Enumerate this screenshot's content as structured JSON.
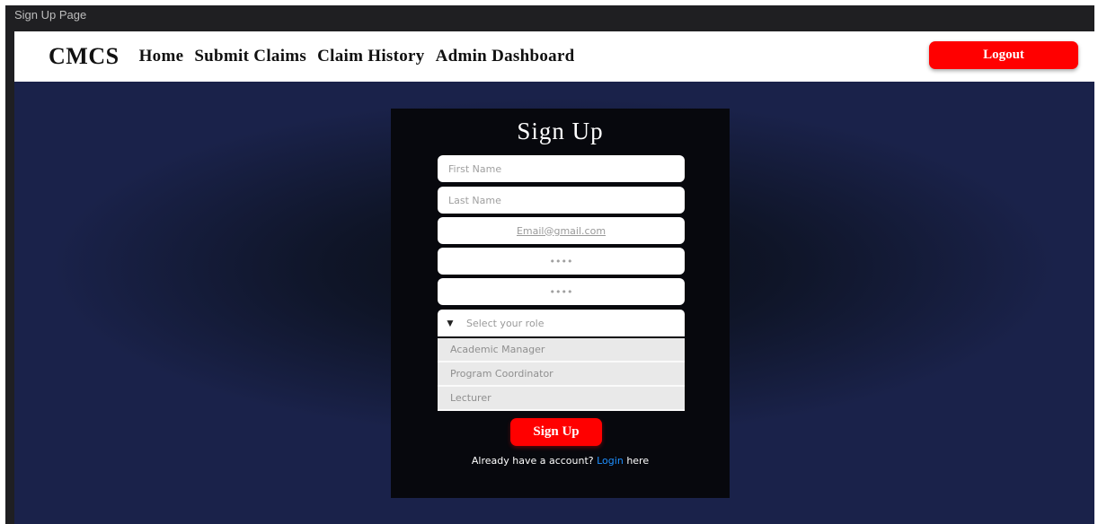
{
  "window": {
    "title": "Sign Up Page"
  },
  "navbar": {
    "brand": "CMCS",
    "links": [
      "Home",
      "Submit Claims",
      "Claim History",
      "Admin Dashboard"
    ],
    "logout_label": "Logout"
  },
  "form": {
    "title": "Sign Up",
    "first_name_placeholder": "First Name",
    "last_name_placeholder": "Last Name",
    "email_placeholder": "Email@gmail.com",
    "password_placeholder": "••••",
    "confirm_password_placeholder": "••••",
    "role_select": {
      "label": "Select your role",
      "options": [
        "Academic Manager",
        "Program Coordinator",
        "Lecturer"
      ]
    },
    "submit_label": "Sign Up",
    "footer": {
      "prefix": "Already have a account?",
      "link": "Login",
      "suffix": "here"
    }
  },
  "colors": {
    "accent": "#ff0000",
    "link": "#1e90ff",
    "background": "#1a224a"
  },
  "icons": {
    "select_arrow": "triangle-down-icon"
  }
}
